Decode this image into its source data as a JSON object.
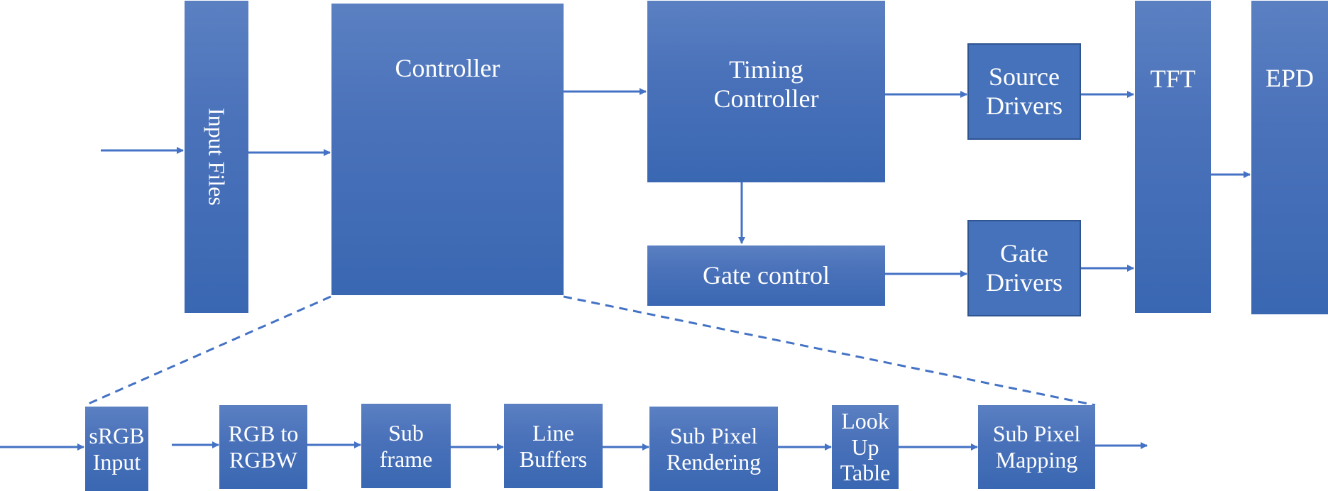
{
  "colors": {
    "box_fill_top": "#5b80c2",
    "box_fill_bottom": "#3a67b2",
    "line": "#4472c4",
    "text": "#ffffff"
  },
  "top_row": {
    "input_files": "Input Files",
    "controller": "Controller",
    "timing_controller": "Timing\nController",
    "gate_control": "Gate control",
    "source_drivers": "Source\nDrivers",
    "gate_drivers": "Gate\nDrivers",
    "tft": "TFT",
    "epd": "EPD"
  },
  "pipeline": [
    {
      "label": "sRGB\nInput"
    },
    {
      "label": "RGB to\nRGBW"
    },
    {
      "label": "Sub\nframe"
    },
    {
      "label": "Line\nBuffers"
    },
    {
      "label": "Sub Pixel\nRendering"
    },
    {
      "label": "Look Up\nTable"
    },
    {
      "label": "Sub Pixel\nMapping"
    }
  ],
  "connections": [
    {
      "from": "external-input",
      "to": "input_files"
    },
    {
      "from": "input_files",
      "to": "controller"
    },
    {
      "from": "controller",
      "to": "timing_controller"
    },
    {
      "from": "timing_controller",
      "to": "source_drivers"
    },
    {
      "from": "timing_controller",
      "to": "gate_control"
    },
    {
      "from": "gate_control",
      "to": "gate_drivers"
    },
    {
      "from": "source_drivers",
      "to": "tft"
    },
    {
      "from": "gate_drivers",
      "to": "tft"
    },
    {
      "from": "tft",
      "to": "epd"
    },
    {
      "from": "controller",
      "to": "pipeline",
      "style": "dashed-zoom"
    }
  ]
}
